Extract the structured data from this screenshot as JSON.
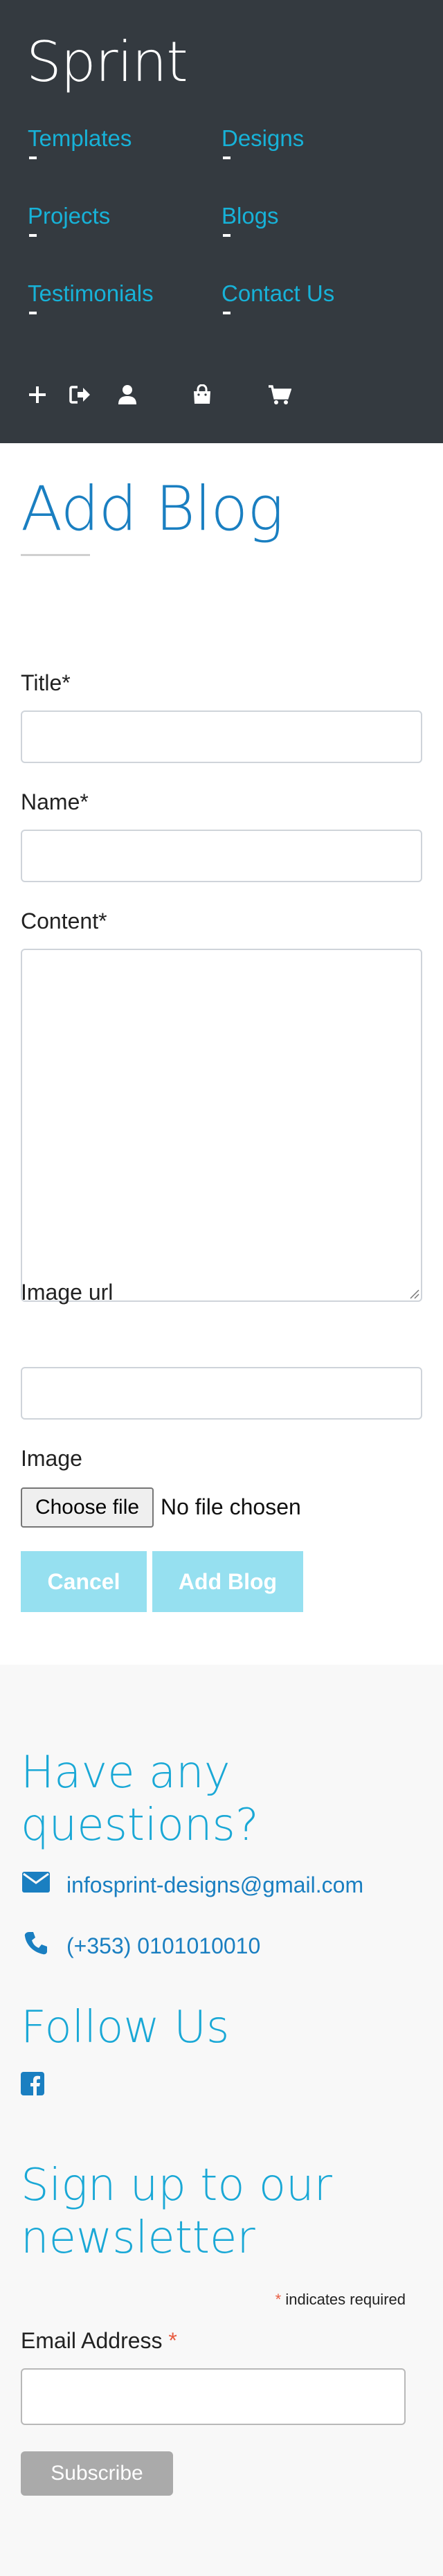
{
  "header": {
    "brand": "Sprint",
    "nav": [
      {
        "label": "Templates"
      },
      {
        "label": "Designs"
      },
      {
        "label": "Projects"
      },
      {
        "label": "Blogs"
      },
      {
        "label": "Testimonials"
      },
      {
        "label": "Contact Us"
      }
    ],
    "icons": [
      "plus-icon",
      "sign-out-icon",
      "user-icon",
      "shopping-bag-icon",
      "cart-icon"
    ]
  },
  "main": {
    "title": "Add Blog",
    "form": {
      "title_label": "Title*",
      "title_value": "",
      "name_label": "Name*",
      "name_value": "",
      "content_label": "Content*",
      "content_value": "",
      "image_url_label": "Image url",
      "image_url_value": "",
      "image_label": "Image",
      "choose_file": "Choose file",
      "no_file": "No file chosen",
      "cancel": "Cancel",
      "submit": "Add Blog"
    },
    "button_color": "#96e0f0"
  },
  "footer": {
    "questions_heading_1": "Have any",
    "questions_heading_2": "questions?",
    "email": "infosprint-designs@gmail.com",
    "phone": "(+353) 0101010010",
    "follow_heading": "Follow Us",
    "social": [
      "facebook-icon"
    ],
    "newsletter_heading_1": "Sign up to our",
    "newsletter_heading_2": "newsletter",
    "required_star": "*",
    "required_note": " indicates required",
    "email_label": "Email Address ",
    "email_star": "*",
    "subscribe": "Subscribe"
  },
  "colors": {
    "header_bg": "#343a40",
    "link": "#17b2d8",
    "title": "#1a7fc1",
    "footer_heading": "#1aa8d6"
  }
}
